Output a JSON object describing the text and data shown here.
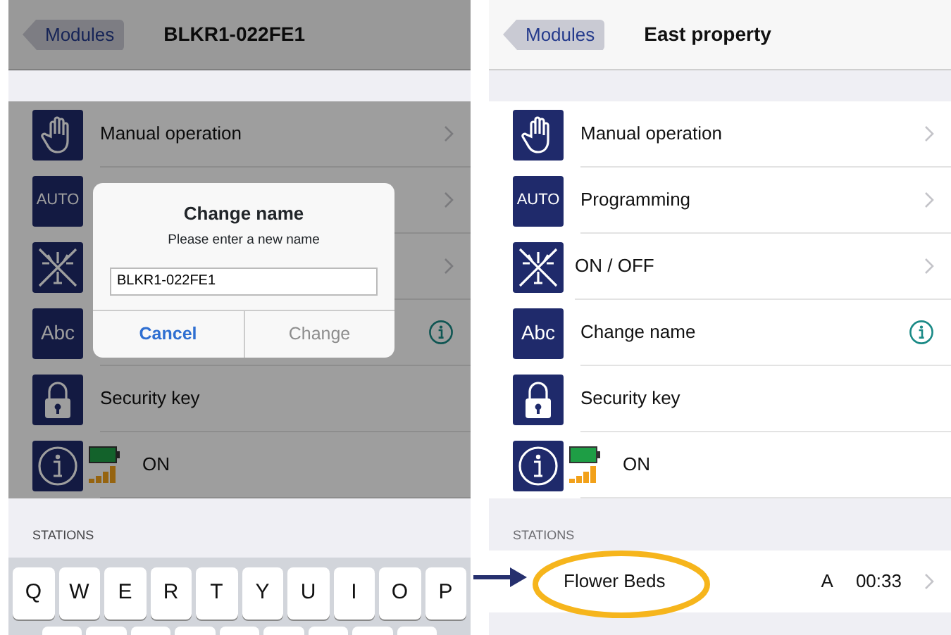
{
  "panels": [
    {
      "dimmed": true,
      "back_button": "Modules",
      "title": "BLKR1-022FE1",
      "menu": [
        {
          "kind": "hand",
          "label": "Manual operation",
          "disclosure": true
        },
        {
          "kind": "auto",
          "icon_text": "AUTO",
          "disclosure": true
        },
        {
          "kind": "sprinkler",
          "disclosure": true
        },
        {
          "kind": "abc",
          "icon_text": "Abc",
          "info_button": true
        },
        {
          "kind": "lock",
          "label": "Security key"
        },
        {
          "kind": "status",
          "label": "ON"
        }
      ],
      "section": "STATIONS",
      "dialog": {
        "title": "Change name",
        "message": "Please enter a new name",
        "value": "BLKR1-022FE1",
        "buttons": [
          {
            "label": "Cancel",
            "primary": true
          },
          {
            "label": "Change",
            "primary": false
          }
        ]
      },
      "keyboard": {
        "keys": [
          "Q",
          "W",
          "E",
          "R",
          "T",
          "Y",
          "U",
          "I",
          "O",
          "P"
        ]
      }
    },
    {
      "dimmed": false,
      "back_button": "Modules",
      "title": "East property",
      "menu": [
        {
          "kind": "hand",
          "label": "Manual operation",
          "disclosure": true
        },
        {
          "kind": "auto",
          "icon_text": "AUTO",
          "label": "Programming",
          "disclosure": true
        },
        {
          "kind": "sprinkler",
          "label": "ON / OFF",
          "disclosure": true
        },
        {
          "kind": "abc",
          "icon_text": "Abc",
          "label": "Change name",
          "info_button": true
        },
        {
          "kind": "lock",
          "label": "Security key"
        },
        {
          "kind": "status",
          "label": "ON"
        }
      ],
      "section": "STATIONS",
      "stations": [
        {
          "label": "Flower Beds",
          "program": "A",
          "time": "00:33",
          "circled": true
        }
      ]
    }
  ],
  "annotations": {
    "arrow": true
  }
}
